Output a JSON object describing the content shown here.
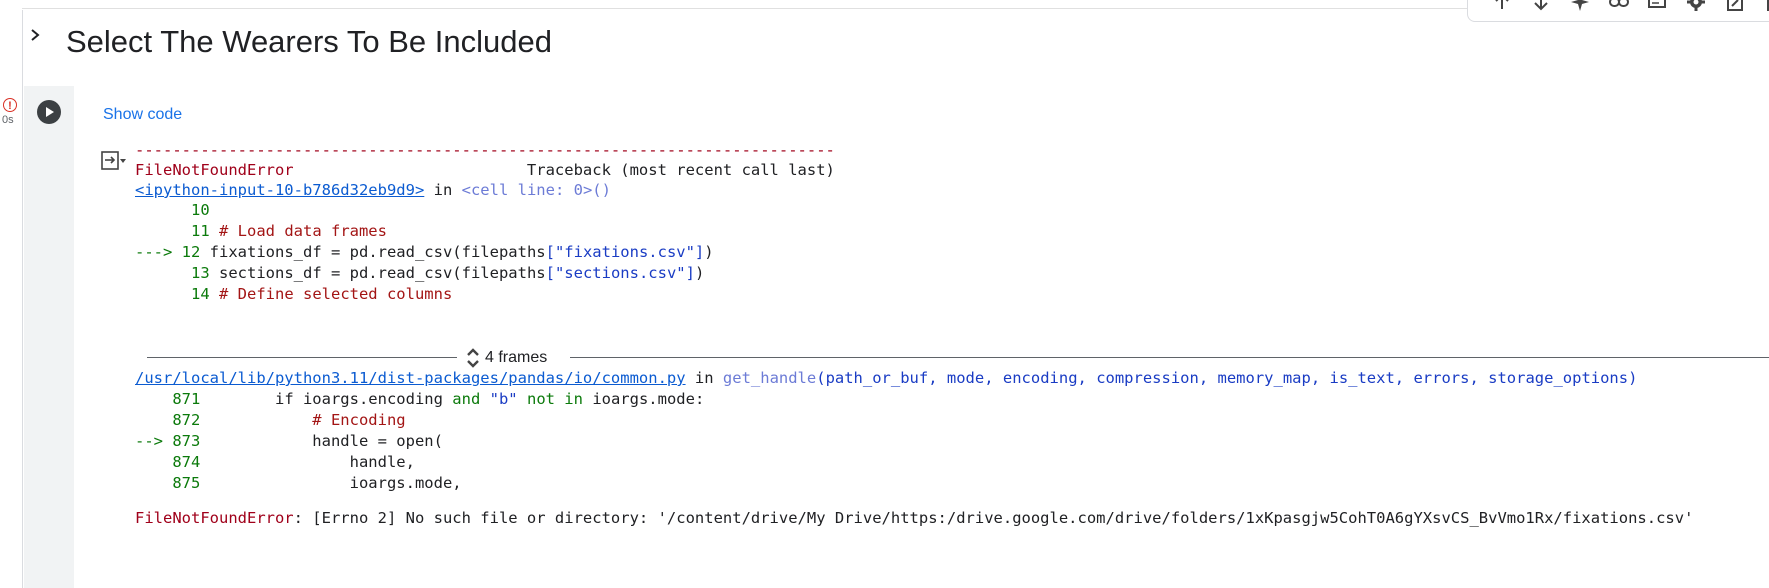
{
  "cell": {
    "heading": "Select The Wearers To Be Included",
    "exec_time": "0s",
    "show_code_label": "Show code"
  },
  "traceback": {
    "dashes": "---------------------------------------------------------------------------",
    "error_name": "FileNotFoundError",
    "traceback_header": "                         Traceback (most recent call last)",
    "frame1_link": "<ipython-input-10-b786d32eb9d9>",
    "frame1_in": " in ",
    "frame1_location": "<cell line: 0>()",
    "lines1": [
      {
        "arrow": "      ",
        "num": "10",
        "code": ""
      },
      {
        "arrow": "      ",
        "num": "11",
        "code": " # Load data frames"
      },
      {
        "arrow": "---> ",
        "num": "12",
        "code": " fixations_df = pd.read_csv(filepaths[\"fixations.csv\"])"
      },
      {
        "arrow": "      ",
        "num": "13",
        "code": " sections_df = pd.read_csv(filepaths[\"sections.csv\"])"
      },
      {
        "arrow": "      ",
        "num": "14",
        "code": " # Define selected columns"
      }
    ],
    "frames_label": "4 frames",
    "frame2_link": "/usr/local/lib/python3.11/dist-packages/pandas/io/common.py",
    "frame2_in": " in ",
    "frame2_func": "get_handle",
    "frame2_args": "(path_or_buf, mode, encoding, compression, memory_map, is_text, errors, storage_options)",
    "lines2": [
      {
        "arrow": "    ",
        "num": "871",
        "code": "        if ioargs.encoding and \"b\" not in ioargs.mode:"
      },
      {
        "arrow": "    ",
        "num": "872",
        "code": "            # Encoding"
      },
      {
        "arrow": "--> ",
        "num": "873",
        "code": "            handle = open("
      },
      {
        "arrow": "    ",
        "num": "874",
        "code": "                handle,"
      },
      {
        "arrow": "    ",
        "num": "875",
        "code": "                ioargs.mode,"
      }
    ],
    "final_error_name": "FileNotFoundError",
    "final_error_msg": ": [Errno 2] No such file or directory: '/content/drive/My Drive/https:/drive.google.com/drive/folders/1xKpasgjw5CohT0A6gYXsvCS_BvVmo1Rx/fixations.csv'"
  },
  "toolbar": {
    "icons": [
      "arrow-up-icon",
      "arrow-down-icon",
      "sparkle-icon",
      "link-icon",
      "comment-icon",
      "gear-icon",
      "mirror-icon",
      "more-icon"
    ]
  },
  "colors": {
    "error": "#a0001a",
    "link": "#0b5bd1",
    "line_number": "#0b7a0b"
  }
}
